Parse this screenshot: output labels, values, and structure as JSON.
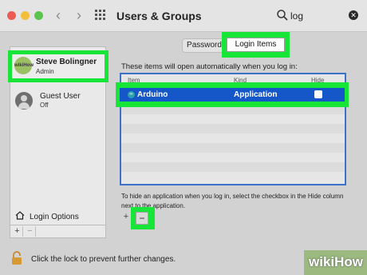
{
  "window": {
    "title": "Users & Groups"
  },
  "search": {
    "value": "log"
  },
  "icons": {
    "back": "chevron-left-icon",
    "forward": "chevron-right-icon",
    "grid": "grid-icon",
    "search": "search-icon",
    "clear": "clear-icon",
    "home": "home-icon",
    "lock": "lock-icon"
  },
  "sidebar": {
    "users": [
      {
        "name": "Steve Bolingner",
        "role": "Admin",
        "avatar_text": "wikiHow",
        "selected": true
      },
      {
        "name": "Guest User",
        "role": "Off",
        "selected": false
      }
    ],
    "login_options": "Login Options",
    "add": "+",
    "remove": "−"
  },
  "tabs": [
    {
      "label": "Password",
      "active": false
    },
    {
      "label": "Login Items",
      "active": true
    }
  ],
  "login_items": {
    "intro": "These items will open automatically when you log in:",
    "columns": [
      "Item",
      "Kind",
      "Hide"
    ],
    "rows": [
      {
        "item": "Arduino",
        "kind": "Application",
        "hide": false,
        "selected": true
      }
    ],
    "hint": "To hide an application when you log in, select the checkbox in the Hide column next to the application.",
    "add": "+",
    "remove": "−"
  },
  "footer": {
    "lock_text": "Click the lock to prevent further changes."
  },
  "watermark": {
    "text": "wikiHow"
  },
  "colors": {
    "highlight": "#17e639",
    "selection": "#1557c9",
    "table_border": "#3c72c8"
  }
}
